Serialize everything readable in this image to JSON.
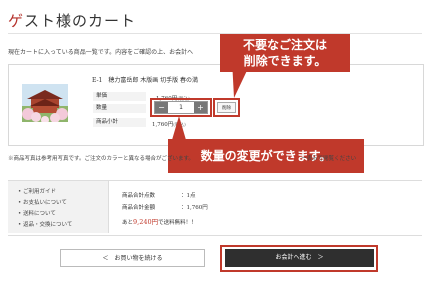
{
  "page": {
    "title_first": "ゲ",
    "title_rest": "スト様のカート",
    "intro": "現在カートに入っている商品一覧です。内容をご確認の上、お会計へ"
  },
  "item": {
    "name": "E-1　穂力富岳郎 木版画 切手版 春の満",
    "labels": {
      "price": "単価",
      "quantity": "数量",
      "subtotal": "商品小計"
    },
    "price": "1,760円",
    "price_tax": "(税込)",
    "quantity": "1",
    "subtotal": "1,760円",
    "subtotal_tax": "(税込)",
    "minus": "−",
    "plus": "+",
    "delete_label": "削除"
  },
  "callouts": {
    "delete": [
      "不要なご注文は",
      "削除できます。"
    ],
    "quantity": "数量の変更ができます。"
  },
  "note": "※商品写真は参考用写真です。ご注文のカラーと異なる場合がございます。　　　　　　　　　　　　　　　　　　　　ー表示で閲覧ください",
  "guide_links": [
    "ご利用ガイド",
    "お支払いについて",
    "送料について",
    "返品・交換について"
  ],
  "summary": {
    "count_label": "商品合計点数",
    "count_value": "：1点",
    "amount_label": "商品合計金額",
    "amount_value": "：1,760円",
    "free_shipping_prefix": "あと",
    "free_shipping_amount": "9,240円",
    "free_shipping_suffix": "で送料無料！！"
  },
  "buttons": {
    "continue": "＜　お買い物を続ける",
    "checkout": "お会計へ進む　＞"
  },
  "colors": {
    "accent": "#c0392b",
    "checkout_bg": "#2f2f2f"
  }
}
